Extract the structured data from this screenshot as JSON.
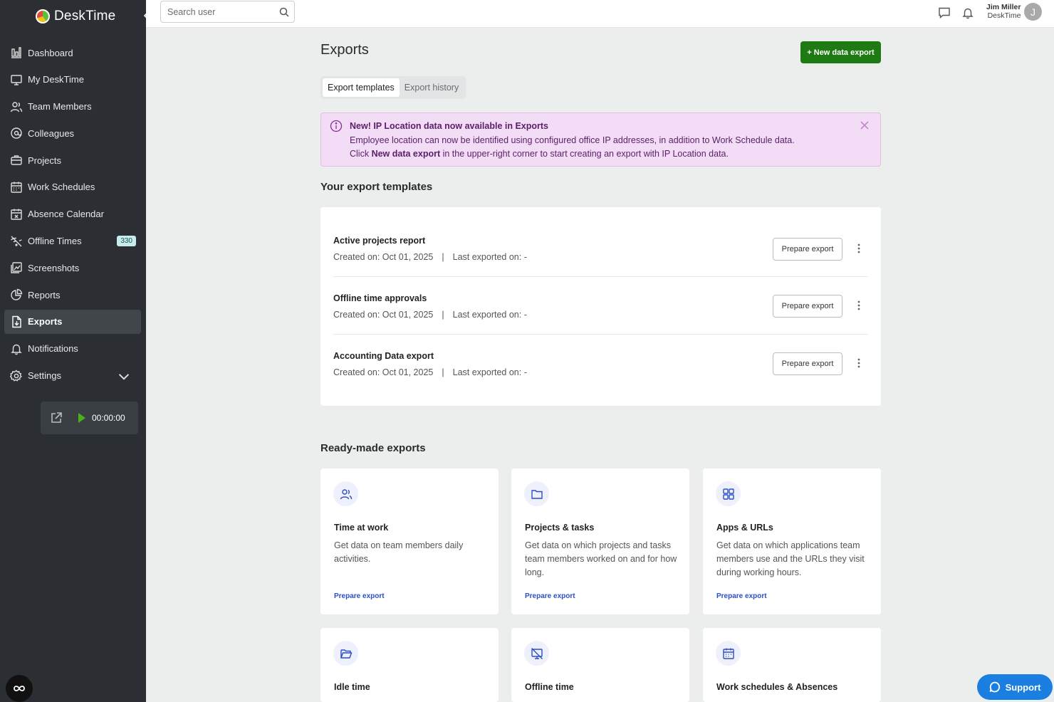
{
  "app": {
    "name": "DeskTime"
  },
  "search": {
    "placeholder": "Search user"
  },
  "user": {
    "name": "Jim Miller",
    "company": "DeskTime",
    "initial": "J"
  },
  "sidebar": {
    "items": [
      {
        "label": "Dashboard",
        "icon": "bar-chart-icon"
      },
      {
        "label": "My DeskTime",
        "icon": "monitor-icon"
      },
      {
        "label": "Team Members",
        "icon": "users-icon"
      },
      {
        "label": "Colleagues",
        "icon": "at-sign-icon"
      },
      {
        "label": "Projects",
        "icon": "briefcase-icon"
      },
      {
        "label": "Work Schedules",
        "icon": "calendar-icon"
      },
      {
        "label": "Absence Calendar",
        "icon": "calendar-x-icon"
      },
      {
        "label": "Offline Times",
        "icon": "wifi-off-icon",
        "badge": "330"
      },
      {
        "label": "Screenshots",
        "icon": "screenshot-icon"
      },
      {
        "label": "Reports",
        "icon": "pie-chart-icon"
      },
      {
        "label": "Exports",
        "icon": "file-download-icon",
        "active": true
      },
      {
        "label": "Notifications",
        "icon": "bell-icon"
      },
      {
        "label": "Settings",
        "icon": "gear-icon"
      }
    ],
    "timer": "00:00:00"
  },
  "page": {
    "title": "Exports",
    "new_export_label": "+ New data export",
    "tabs": [
      "Export templates",
      "Export history"
    ]
  },
  "banner": {
    "title": "New! IP Location data now available in Exports",
    "line1": "Employee location can now be identified using configured office IP addresses, in addition to Work Schedule data.",
    "line2_prefix": "Click ",
    "line2_bold": "New data export",
    "line2_suffix": " in the upper-right corner to start creating an export with IP Location data."
  },
  "templates": {
    "title": "Your export templates",
    "button_label": "Prepare export",
    "items": [
      {
        "name": "Active projects report",
        "created": "Created on: Oct 01, 2025",
        "last": "Last exported on: -"
      },
      {
        "name": "Offline time approvals",
        "created": "Created on: Oct 01, 2025",
        "last": "Last exported on: -"
      },
      {
        "name": "Accounting Data export",
        "created": "Created on: Oct 01, 2025",
        "last": "Last exported on: -"
      }
    ]
  },
  "readymade": {
    "title": "Ready-made exports",
    "link_label": "Prepare export",
    "cards": [
      {
        "title": "Time at work",
        "desc": "Get data on team members daily activities.",
        "icon": "users-icon"
      },
      {
        "title": "Projects & tasks",
        "desc": "Get data on which projects and tasks team members worked on and for how long.",
        "icon": "folder-icon"
      },
      {
        "title": "Apps & URLs",
        "desc": "Get data on which applications team members use and the URLs they visit during working hours.",
        "icon": "grid-icon"
      },
      {
        "title": "Idle time",
        "desc": "",
        "icon": "folder-open-icon"
      },
      {
        "title": "Offline time",
        "desc": "",
        "icon": "monitor-off-icon"
      },
      {
        "title": "Work schedules & Absences",
        "desc": "",
        "icon": "calendar-icon"
      }
    ]
  },
  "support": {
    "label": "Support"
  },
  "colors": {
    "sidebar_bg": "#2b2f33",
    "primary_green": "#1e7a13",
    "banner_bg": "#f3dcf5",
    "link_blue": "#2c4ec7",
    "support_blue": "#1a7fe0"
  }
}
